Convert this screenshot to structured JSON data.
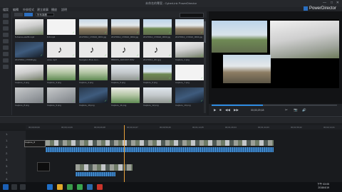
{
  "window": {
    "title": "未命名的專案 - CyberLink PowerDirector",
    "brand": "PowerDirector",
    "win_min": "—",
    "win_max": "□",
    "win_close": "✕"
  },
  "menu": {
    "items": [
      "檔案",
      "編輯",
      "外掛程式",
      "建立故事",
      "播放",
      "說明"
    ]
  },
  "library": {
    "filter_value": "所有媒體",
    "items": [
      {
        "label": "S-Fence+stuff4.mp4",
        "style": "wall"
      },
      {
        "label": "DJI.mp4",
        "style": "white"
      },
      {
        "label": "20170612_170924_0001.jpg",
        "style": "site"
      },
      {
        "label": "20170612_170924_0002.jpg",
        "style": "site"
      },
      {
        "label": "20170612_170924_0003.jpg",
        "style": "sky"
      },
      {
        "label": "20170612_170924_0004.jpg",
        "style": "site"
      },
      {
        "label": "20170612_170930.jpg",
        "style": "dark"
      },
      {
        "label": "voice.mp3",
        "style": "audio"
      },
      {
        "label": "Navigator-Brun-Hon...",
        "style": "audio"
      },
      {
        "label": "8BIRDS_AIRCRFT.WAV",
        "style": "audio"
      },
      {
        "label": "20170612_201.jpg",
        "style": "audio"
      },
      {
        "label": "Capture_1.png",
        "style": "wall"
      },
      {
        "label": "Capture_2.png",
        "style": "wall"
      },
      {
        "label": "Capture_3.png",
        "style": "green"
      },
      {
        "label": "Capture_4.png",
        "style": "green"
      },
      {
        "label": "Capture_5.png",
        "style": "stone"
      },
      {
        "label": "Capture_6.png",
        "style": "sky"
      },
      {
        "label": "Capture_7.png",
        "style": "white"
      },
      {
        "label": "Capture_8.png",
        "style": "grey"
      },
      {
        "label": "Capture_9.png",
        "style": "grey"
      },
      {
        "label": "Capture_10.png",
        "style": "dark"
      },
      {
        "label": "Capture_11.png",
        "style": "green"
      },
      {
        "label": "Capture_12.png",
        "style": "stone"
      },
      {
        "label": "Capture_13.png",
        "style": "dark"
      }
    ]
  },
  "player": {
    "timecode": "00;00;29;18",
    "controls": [
      "▶",
      "■",
      "◀◀",
      "▶▶",
      "✂",
      "📷",
      "🔊"
    ]
  },
  "timeline": {
    "ticks": [
      "00;00;00;00",
      "00;00;14;29",
      "00;00;29;28",
      "00;00;44;27",
      "00;00;59;26",
      "00;01;14;25",
      "00;01;29;24",
      "00;01;44;23",
      "00;01;59;22",
      "00;02;14;21"
    ],
    "tracks": [
      "1.",
      "1.",
      "2.",
      "2.",
      "3.",
      "3.",
      "4.",
      "4."
    ],
    "title_clip_label": "Capture_8",
    "black_clip_label": ""
  },
  "taskbar": {
    "time": "下午 03:05",
    "date": "2018/4/19"
  }
}
